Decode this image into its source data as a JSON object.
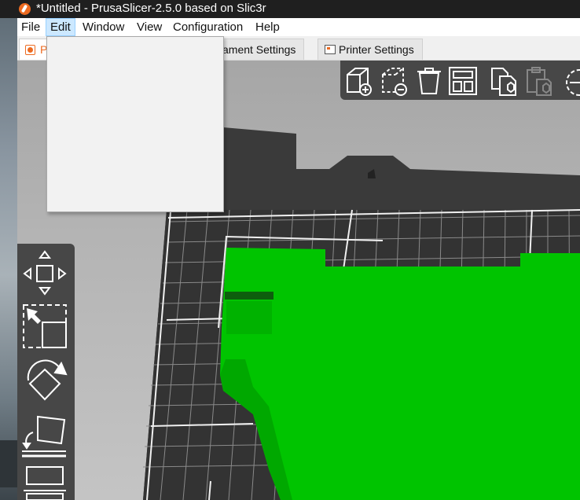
{
  "window": {
    "title": "*Untitled - PrusaSlicer-2.5.0 based on Slic3r",
    "app_icon": "prusaslicer-logo-icon"
  },
  "menubar": {
    "items": [
      {
        "label": "File"
      },
      {
        "label": "Edit",
        "active": true
      },
      {
        "label": "Window"
      },
      {
        "label": "View"
      },
      {
        "label": "Configuration"
      },
      {
        "label": "Help"
      }
    ]
  },
  "tabs": [
    {
      "label": "P",
      "icon": "plater-icon",
      "selected": true
    },
    {
      "label": "ament Settings",
      "icon": "filament-icon"
    },
    {
      "label": "Printer Settings",
      "icon": "printer-icon"
    }
  ],
  "toolbar_top": {
    "buttons": [
      "add-object-icon",
      "delete-object-icon",
      "delete-all-icon",
      "arrange-icon",
      "copy-icon",
      "paste-icon",
      "split-icon"
    ]
  },
  "toolbar_left": {
    "buttons": [
      "move-icon",
      "scale-icon",
      "rotate-icon",
      "place-on-face-icon",
      "cut-icon"
    ]
  },
  "colors": {
    "object": "#00c400",
    "bed": "#3b3b3b",
    "accent": "#ed6b21",
    "toolbar": "#474747"
  },
  "edit_menu": {
    "open": true,
    "items": []
  }
}
